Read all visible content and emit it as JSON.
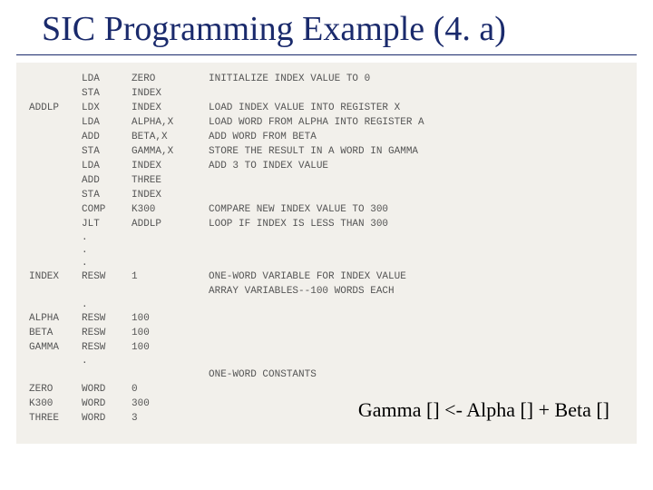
{
  "title": "SIC Programming Example (4. a)",
  "footer_expr": "Gamma [] <- Alpha [] + Beta []",
  "code": {
    "block1": [
      {
        "label": "",
        "op": "LDA",
        "operand": "ZERO",
        "comment": "INITIALIZE INDEX VALUE TO 0"
      },
      {
        "label": "",
        "op": "STA",
        "operand": "INDEX",
        "comment": ""
      },
      {
        "label": "ADDLP",
        "op": "LDX",
        "operand": "INDEX",
        "comment": "LOAD INDEX VALUE INTO REGISTER X"
      },
      {
        "label": "",
        "op": "LDA",
        "operand": "ALPHA,X",
        "comment": "LOAD WORD FROM ALPHA INTO REGISTER A"
      },
      {
        "label": "",
        "op": "ADD",
        "operand": "BETA,X",
        "comment": "ADD WORD FROM BETA"
      },
      {
        "label": "",
        "op": "STA",
        "operand": "GAMMA,X",
        "comment": "STORE THE RESULT IN A WORD IN GAMMA"
      },
      {
        "label": "",
        "op": "LDA",
        "operand": "INDEX",
        "comment": "ADD 3 TO INDEX VALUE"
      },
      {
        "label": "",
        "op": "ADD",
        "operand": "THREE",
        "comment": ""
      },
      {
        "label": "",
        "op": "STA",
        "operand": "INDEX",
        "comment": ""
      },
      {
        "label": "",
        "op": "COMP",
        "operand": "K300",
        "comment": "COMPARE NEW INDEX VALUE TO 300"
      },
      {
        "label": "",
        "op": "JLT",
        "operand": "ADDLP",
        "comment": "LOOP IF INDEX IS LESS THAN 300"
      }
    ],
    "block2": [
      {
        "label": "INDEX",
        "op": "RESW",
        "operand": "1",
        "comment": "ONE-WORD VARIABLE FOR INDEX VALUE"
      },
      {
        "label": "",
        "op": "",
        "operand": "",
        "comment": "ARRAY VARIABLES--100 WORDS EACH"
      }
    ],
    "block3": [
      {
        "label": "ALPHA",
        "op": "RESW",
        "operand": "100",
        "comment": ""
      },
      {
        "label": "BETA",
        "op": "RESW",
        "operand": "100",
        "comment": ""
      },
      {
        "label": "GAMMA",
        "op": "RESW",
        "operand": "100",
        "comment": ""
      }
    ],
    "block4_comment": "ONE-WORD CONSTANTS",
    "block4": [
      {
        "label": "ZERO",
        "op": "WORD",
        "operand": "0",
        "comment": ""
      },
      {
        "label": "K300",
        "op": "WORD",
        "operand": "300",
        "comment": ""
      },
      {
        "label": "THREE",
        "op": "WORD",
        "operand": "3",
        "comment": ""
      }
    ]
  }
}
